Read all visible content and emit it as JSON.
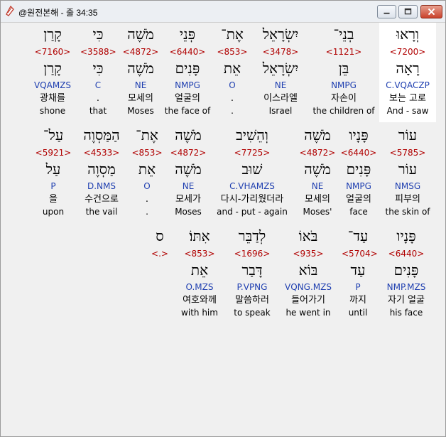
{
  "window": {
    "title": "@원전본해 - 줄 34:35"
  },
  "rows": [
    {
      "cards": [
        {
          "heb": "וְרָאוּ",
          "strong": "<7200>",
          "lemma": "רָאָה",
          "morph": "C.VQACZP",
          "korean": "보는 고로",
          "english": "And - saw",
          "highlight": true
        },
        {
          "heb": "בְנֵי־",
          "strong": "<1121>",
          "lemma": "בֵּן",
          "morph": "NMPG",
          "korean": "자손이",
          "english": "the children of",
          "highlight": false
        },
        {
          "heb": "יִשְׂרָאֵל",
          "strong": "<3478>",
          "lemma": "יִשְׂרָאֵל",
          "morph": "NE",
          "korean": "이스라엘",
          "english": "Israel",
          "highlight": false
        },
        {
          "heb": "אֶת־",
          "strong": "<853>",
          "lemma": "אֵת",
          "morph": "O",
          "korean": ".",
          "english": ".",
          "highlight": false
        },
        {
          "heb": "פְּנֵי",
          "strong": "<6440>",
          "lemma": "פָּנִים",
          "morph": "NMPG",
          "korean": "얼굴의",
          "english": "the face of",
          "highlight": false
        },
        {
          "heb": "מֹשֶׁה",
          "strong": "<4872>",
          "lemma": "מֹשֶׁה",
          "morph": "NE",
          "korean": "모세의",
          "english": "Moses",
          "highlight": false
        },
        {
          "heb": "כִּי",
          "strong": "<3588>",
          "lemma": "כִּי",
          "morph": "C",
          "korean": ".",
          "english": "that",
          "highlight": false
        },
        {
          "heb": "קָרַן",
          "strong": "<7160>",
          "lemma": "קָרַן",
          "morph": "VQAMZS",
          "korean": "광채를",
          "english": "shone",
          "highlight": false
        }
      ]
    },
    {
      "cards": [
        {
          "heb": "עוֹר",
          "strong": "<5785>",
          "lemma": "עוֹר",
          "morph": "NMSG",
          "korean": "피부의",
          "english": "the skin of",
          "highlight": false
        },
        {
          "heb": "פָּנָיו",
          "strong": "<6440>",
          "lemma": "פָּנִים",
          "morph": "NMPG",
          "korean": "얼굴의",
          "english": "face",
          "highlight": false
        },
        {
          "heb": "מֹשֶׁה",
          "strong": "<4872>",
          "lemma": "מֹשֶׁה",
          "morph": "NE",
          "korean": "모세의",
          "english": "Moses'",
          "highlight": false
        },
        {
          "heb": "וְהֵשִׁיב",
          "strong": "<7725>",
          "lemma": "שׁוּב",
          "morph": "C.VHAMZS",
          "korean": "다시-가리웠더라",
          "english": "and - put - again",
          "highlight": false
        },
        {
          "heb": "מֹשֶׁה",
          "strong": "<4872>",
          "lemma": "מֹשֶׁה",
          "morph": "NE",
          "korean": "모세가",
          "english": "Moses",
          "highlight": false
        },
        {
          "heb": "אֶת־",
          "strong": "<853>",
          "lemma": "אֵת",
          "morph": "O",
          "korean": ".",
          "english": ".",
          "highlight": false
        },
        {
          "heb": "הַמַּסְוֶה",
          "strong": "<4533>",
          "lemma": "מַסְוֶה",
          "morph": "D.NMS",
          "korean": "수건으로",
          "english": "the vail",
          "highlight": false
        },
        {
          "heb": "עַל־",
          "strong": "<5921>",
          "lemma": "עַל",
          "morph": "P",
          "korean": "을",
          "english": "upon",
          "highlight": false
        }
      ]
    },
    {
      "cards": [
        {
          "heb": "פָּנָיו",
          "strong": "<6440>",
          "lemma": "פָּנִים",
          "morph": "NMP.MZS",
          "korean": "자기 얼굴",
          "english": "his face",
          "highlight": false
        },
        {
          "heb": "עַד־",
          "strong": "<5704>",
          "lemma": "עַד",
          "morph": "P",
          "korean": "까지",
          "english": "until",
          "highlight": false
        },
        {
          "heb": "בֹּאוֹ",
          "strong": "<935>",
          "lemma": "בּוֹא",
          "morph": "VQNG.MZS",
          "korean": "들어가기",
          "english": "he went in",
          "highlight": false
        },
        {
          "heb": "לְדַבֵּר",
          "strong": "<1696>",
          "lemma": "דָּבַר",
          "morph": "P.VPNG",
          "korean": "말씀하러",
          "english": "to speak",
          "highlight": false
        },
        {
          "heb": "אִתּוֹ׃",
          "strong": "<853>",
          "lemma": "אֵת",
          "morph": "O.MZS",
          "korean": "여호와께",
          "english": "with him",
          "highlight": false
        },
        {
          "heb": "ס",
          "strong": "<.>",
          "lemma": "",
          "morph": "",
          "korean": "",
          "english": "",
          "highlight": false
        }
      ]
    }
  ]
}
